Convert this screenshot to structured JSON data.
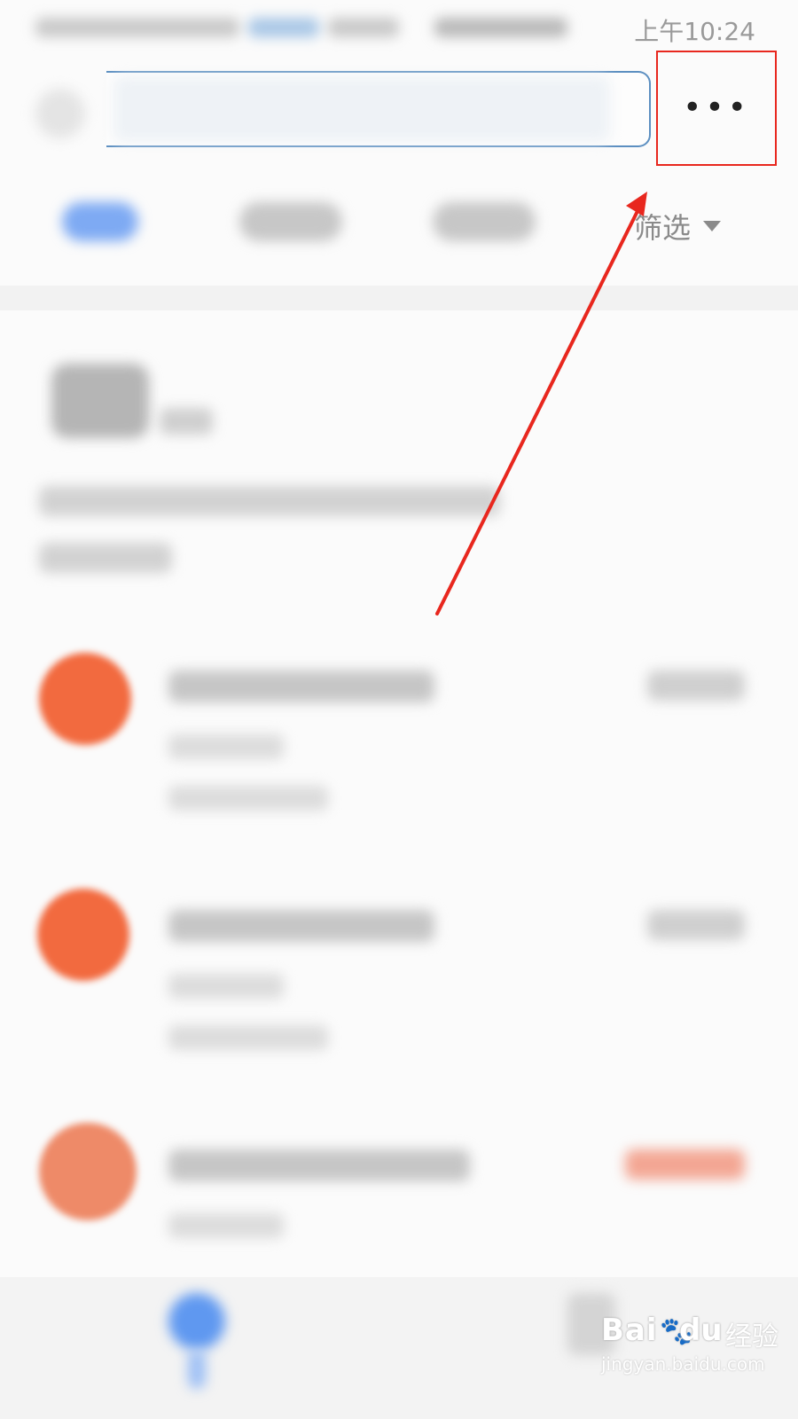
{
  "status_bar": {
    "time": "上午10:24"
  },
  "top_bar": {
    "back_icon": "back-arrow-icon",
    "search_placeholder": "",
    "more_icon": "more-horizontal-icon",
    "more_label": "•••"
  },
  "filter_bar": {
    "filter_label": "筛选",
    "caret_icon": "caret-down-icon"
  },
  "annotation": {
    "color": "#e8271e"
  },
  "colors": {
    "accent_blue": "#7eaaf3",
    "avatar_orange": "#f26a3f",
    "highlight_red": "#e8271e"
  },
  "watermark": {
    "brand": "Bai",
    "brand_suffix": "du",
    "cn": "经验",
    "url": "jingyan.baidu.com"
  }
}
